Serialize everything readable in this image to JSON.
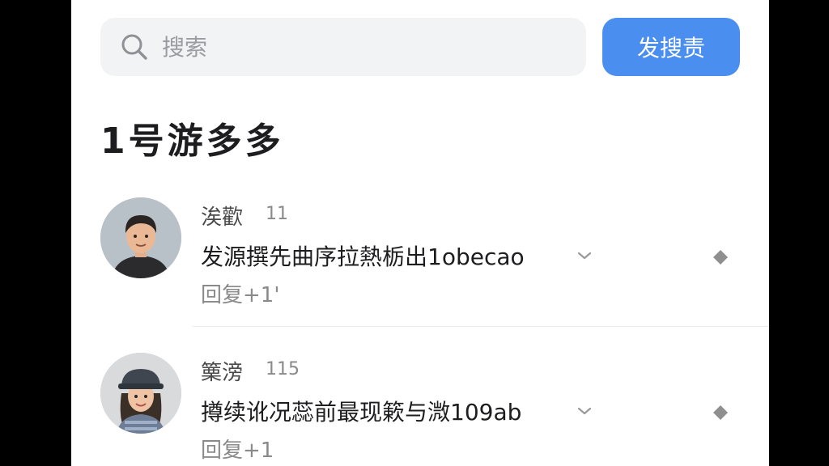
{
  "search": {
    "placeholder": "搜索",
    "button_label": "发搜责"
  },
  "section": {
    "title": "1号游多多"
  },
  "comments": [
    {
      "username": "涘歡",
      "level": "11",
      "text": "发源撰先曲序拉熱栃出1obecao",
      "reply_label": "回复+1'"
    },
    {
      "username": "篥滂",
      "level": "115",
      "text": "撙续讹况蕊前最现簌与溦109ab",
      "reply_label": "回复+1"
    }
  ],
  "colors": {
    "accent": "#4a8ef0",
    "search_bg": "#f2f3f5",
    "background": "#ffffff"
  },
  "icons": {
    "search": "search-icon",
    "expand": "chevron-down-icon",
    "more": "diamond-icon"
  }
}
